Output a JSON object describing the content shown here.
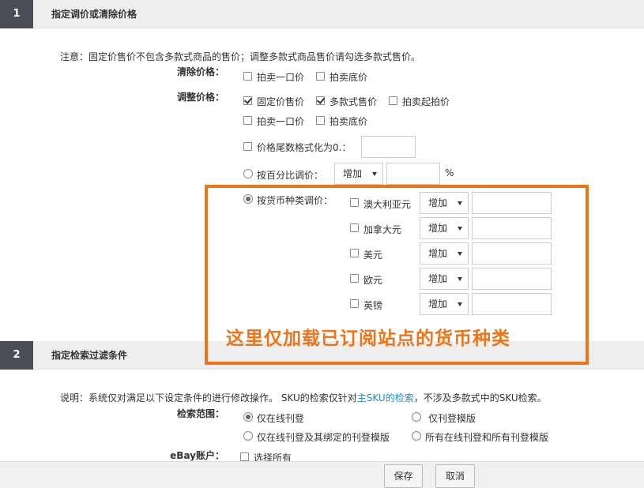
{
  "section1": {
    "number": "1",
    "title": "指定调价或清除价格",
    "note": "注意：固定价售价不包含多款式商品的售价；调整多款式商品售价请勾选多款式售价。",
    "clear_price": {
      "label": "清除价格：",
      "options": [
        {
          "label": "拍卖一口价",
          "checked": false
        },
        {
          "label": "拍卖底价",
          "checked": false
        }
      ]
    },
    "adjust_price": {
      "label": "调整价格：",
      "row1": [
        {
          "label": "固定价售价",
          "checked": true
        },
        {
          "label": "多款式售价",
          "checked": true
        },
        {
          "label": "拍卖起拍价",
          "checked": false
        }
      ],
      "row2": [
        {
          "label": "拍卖一口价",
          "checked": false
        },
        {
          "label": "拍卖底价",
          "checked": false
        }
      ],
      "format_tail": {
        "label": "价格尾数格式化为0.：",
        "checked": false,
        "value": ""
      },
      "by_percent": {
        "label": "按百分比调价：",
        "selected": false,
        "op": "增加",
        "value": "",
        "unit": "%"
      },
      "by_currency": {
        "label": "按货币种类调价：",
        "selected": true,
        "currencies": [
          {
            "name": "澳大利亚元",
            "checked": false,
            "op": "增加",
            "value": ""
          },
          {
            "name": "加拿大元",
            "checked": false,
            "op": "增加",
            "value": ""
          },
          {
            "name": "美元",
            "checked": false,
            "op": "增加",
            "value": ""
          },
          {
            "name": "欧元",
            "checked": false,
            "op": "增加",
            "value": ""
          },
          {
            "name": "英镑",
            "checked": false,
            "op": "增加",
            "value": ""
          }
        ]
      }
    }
  },
  "callout": {
    "text": "这里仅加载已订阅站点的货币种类",
    "color": "#ed7519"
  },
  "section2": {
    "number": "2",
    "title": "指定检索过滤条件",
    "note_prefix": "说明：系统仅对满足以下设定条件的进行修改操作。 SKU的检索仅针对",
    "note_link": "主SKU的检索",
    "note_suffix": "，不涉及多款式中的SKU检索。",
    "scope": {
      "label": "检索范围：",
      "options": [
        {
          "label": "仅在线刊登",
          "selected": true
        },
        {
          "label": "仅刊登模版",
          "selected": false
        },
        {
          "label": "仅在线刊登及其绑定的刊登模版",
          "selected": false
        },
        {
          "label": "所有在线刊登和所有刊登模版",
          "selected": false
        }
      ]
    },
    "account": {
      "label": "eBay账户：",
      "select_all": "选择所有"
    }
  },
  "footer": {
    "save": "保存",
    "cancel": "取消"
  }
}
